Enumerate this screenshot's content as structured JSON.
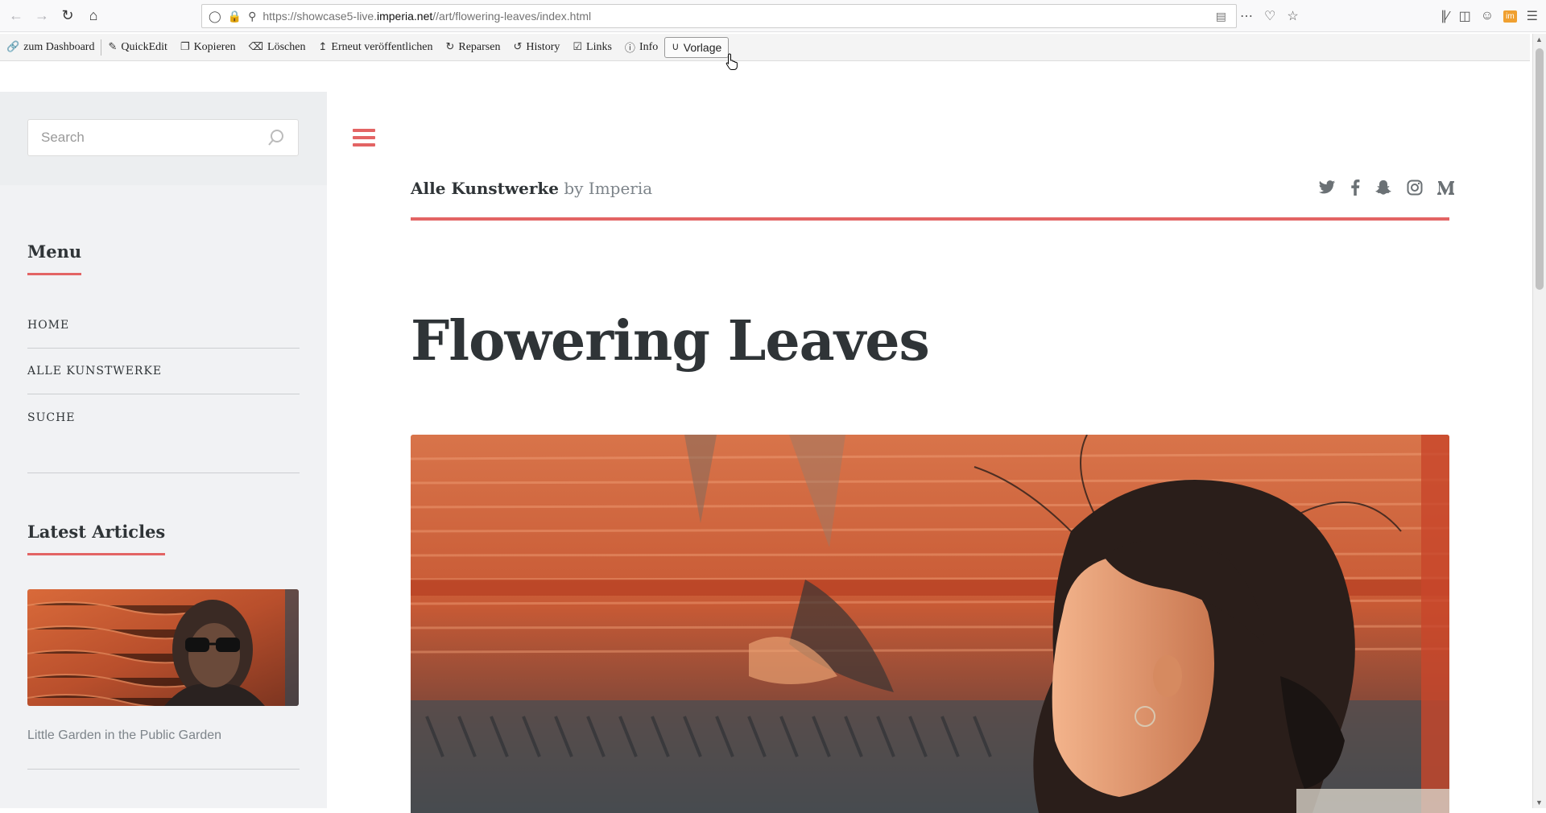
{
  "browser": {
    "url_prefix": "https://showcase5-live.",
    "url_host": "imperia.net",
    "url_path": "//art/flowering-leaves/index.html"
  },
  "toolbar": {
    "items": [
      {
        "icon": "link-icon",
        "label": "zum Dashboard"
      },
      {
        "icon": "edit-icon",
        "label": "QuickEdit"
      },
      {
        "icon": "copy-icon",
        "label": "Kopieren"
      },
      {
        "icon": "eraser-icon",
        "label": "Löschen"
      },
      {
        "icon": "upload-icon",
        "label": "Erneut veröffentlichen"
      },
      {
        "icon": "refresh-icon",
        "label": "Reparsen"
      },
      {
        "icon": "history-icon",
        "label": "History"
      },
      {
        "icon": "check-square-icon",
        "label": "Links"
      },
      {
        "icon": "info-icon",
        "label": "Info"
      },
      {
        "icon": "magnet-icon",
        "label": "Vorlage"
      }
    ]
  },
  "sidebar": {
    "search_placeholder": "Search",
    "menu_heading": "Menu",
    "menu_items": [
      "HOME",
      "ALLE KUNSTWERKE",
      "SUCHE"
    ],
    "latest_heading": "Latest Articles",
    "article_title": "Little Garden in the Public Garden"
  },
  "header": {
    "site_name": "Alle Kunstwerke",
    "by_text": "by Imperia",
    "socials": [
      "twitter-icon",
      "facebook-icon",
      "snapchat-icon",
      "instagram-icon",
      "medium-icon"
    ]
  },
  "page": {
    "title": "Flowering Leaves"
  },
  "colors": {
    "accent": "#e36464",
    "text": "#2f3437",
    "sidebar_bg": "#f1f2f4"
  }
}
